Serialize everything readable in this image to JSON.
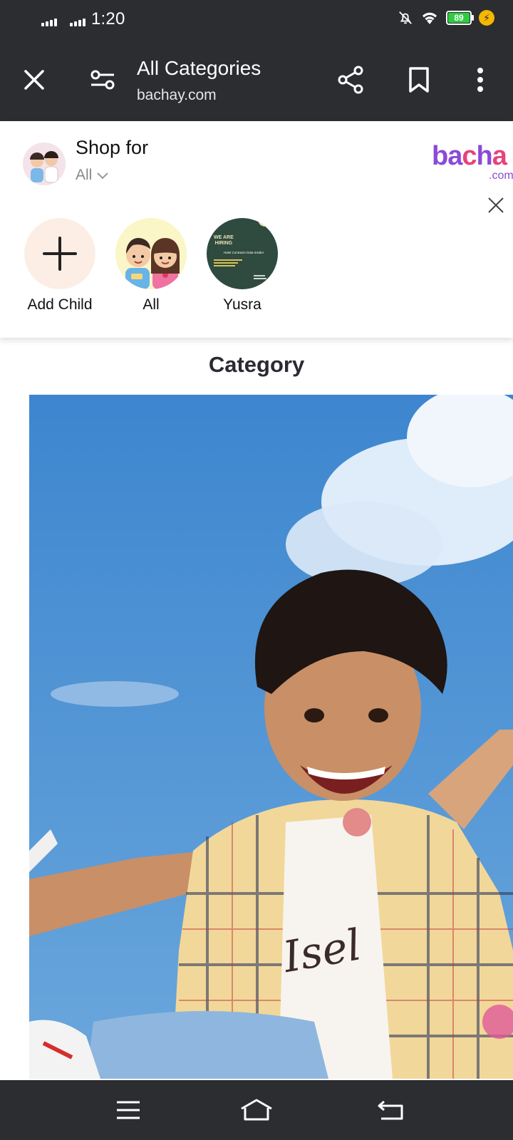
{
  "status_bar": {
    "time": "1:20",
    "battery_level": "89",
    "icons": [
      "signal-icon",
      "signal-icon",
      "mute-icon",
      "wifi-icon",
      "battery-icon",
      "charging-icon"
    ]
  },
  "toolbar": {
    "title": "All Categories",
    "url": "bachay.com",
    "icons": [
      "close-icon",
      "page-settings-icon",
      "share-icon",
      "bookmark-icon",
      "more-vert-icon"
    ]
  },
  "shop_for": {
    "title": "Shop for",
    "selected": "All",
    "brand_logo": "bachay",
    "brand_suffix": ".com",
    "children": [
      {
        "label": "Add Child",
        "icon": "plus-icon"
      },
      {
        "label": "All",
        "icon": "kids-avatar"
      },
      {
        "label": "Yusra",
        "icon": "hiring-poster-avatar"
      }
    ],
    "poster_text": {
      "line1": "WE ARE",
      "line2": "HIRING",
      "line3": "Hotel Contracts Data Insider"
    }
  },
  "category": {
    "title": "Category"
  },
  "colors": {
    "bar": "#2b2d31",
    "accent_battery": "#2ecc40",
    "brand_purple": "#8a4bd6",
    "brand_pink": "#e6447a"
  },
  "nav_bar": {
    "icons": [
      "menu-icon",
      "home-icon",
      "back-icon"
    ]
  }
}
